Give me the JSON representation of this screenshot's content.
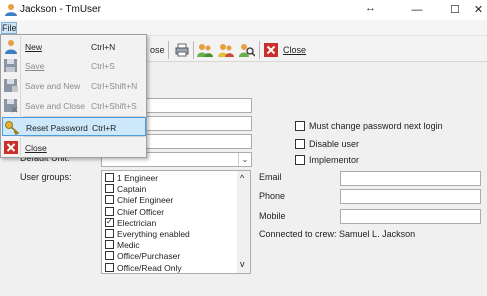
{
  "window": {
    "title": "Jackson - TmUser",
    "resize_glyph": "↔",
    "minimize": "—",
    "maximize": "☐",
    "close": "✕"
  },
  "menubar": {
    "file": "File"
  },
  "toolbar": {
    "close_suffix": "ose",
    "close_label": "Close"
  },
  "file_menu": {
    "items": [
      {
        "label": "New",
        "shortcut": "Ctrl+N",
        "enabled": true
      },
      {
        "label": "Save",
        "shortcut": "Ctrl+S",
        "enabled": false
      },
      {
        "label": "Save and New",
        "shortcut": "Ctrl+Shift+N",
        "enabled": false
      },
      {
        "label": "Save and Close",
        "shortcut": "Ctrl+Shift+S",
        "enabled": false
      },
      {
        "label": "Reset Password",
        "shortcut": "Ctrl+R",
        "enabled": true,
        "highlighted": true
      },
      {
        "label": "Close",
        "shortcut": "",
        "enabled": true
      }
    ]
  },
  "form": {
    "default_unit_label": "Default Unit:",
    "user_groups_label": "User groups:",
    "must_change_password_label": "Must change password next login",
    "disable_user_label": "Disable user",
    "implementor_label": "Implementor",
    "email_label": "Email",
    "phone_label": "Phone",
    "mobile_label": "Mobile",
    "connected_text": "Connected to crew: Samuel L. Jackson",
    "groups": [
      {
        "label": "1 Engineer",
        "checked": false
      },
      {
        "label": "Captain",
        "checked": false
      },
      {
        "label": "Chief Engineer",
        "checked": false
      },
      {
        "label": "Chief Officer",
        "checked": false
      },
      {
        "label": "Electrician",
        "checked": true
      },
      {
        "label": "Everything enabled",
        "checked": false
      },
      {
        "label": "Medic",
        "checked": false
      },
      {
        "label": "Office/Purchaser",
        "checked": false
      },
      {
        "label": "Office/Read Only",
        "checked": false
      }
    ],
    "scroll_up": "^",
    "scroll_down": "v",
    "combo_arrow": "⌄"
  }
}
